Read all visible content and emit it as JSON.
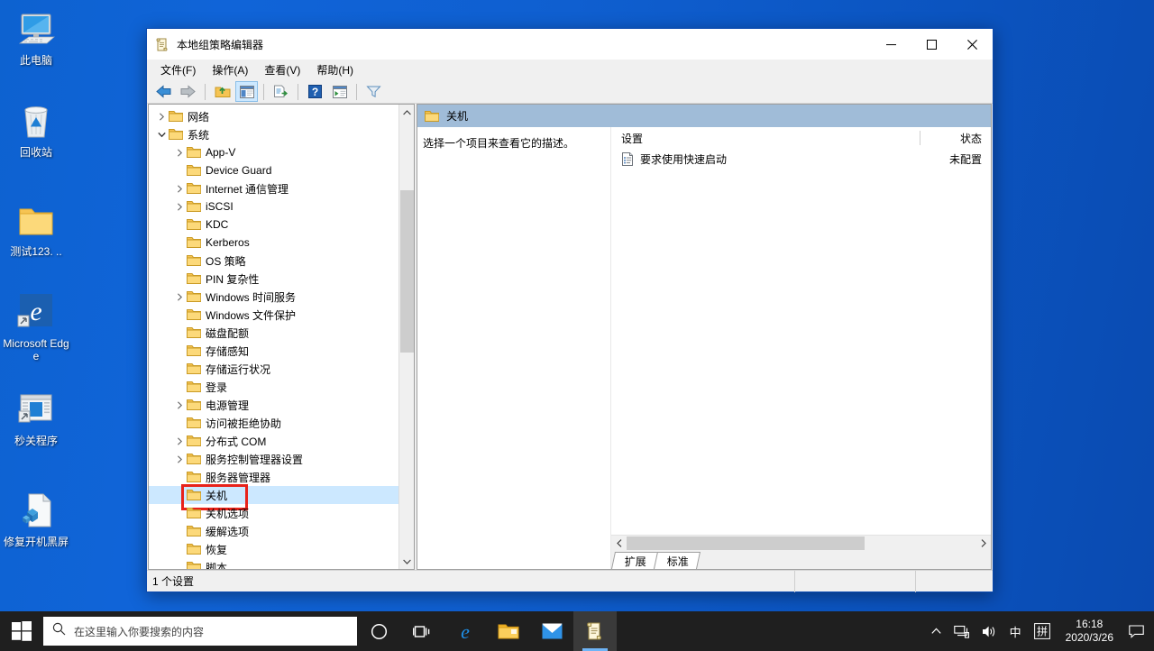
{
  "desktop": {
    "icons": [
      {
        "name": "this-pc",
        "label": "此电脑"
      },
      {
        "name": "recycle-bin",
        "label": "回收站"
      },
      {
        "name": "folder-test123",
        "label": "测试123. .."
      },
      {
        "name": "microsoft-edge",
        "label": "Microsoft Edge"
      },
      {
        "name": "quick-shutdown-program",
        "label": "秒关程序"
      },
      {
        "name": "fix-black-screen",
        "label": "修复开机黑屏"
      }
    ]
  },
  "window": {
    "title": "本地组策略编辑器",
    "icon": "policy-scroll-icon",
    "controls": {
      "minimize": "—",
      "maximize": "☐",
      "close": "✕"
    },
    "menu": [
      "文件(F)",
      "操作(A)",
      "查看(V)",
      "帮助(H)"
    ],
    "toolbar_icons": [
      "back-arrow-icon",
      "forward-arrow-icon",
      "up-folder-icon",
      "show-hide-tree-icon",
      "export-list-icon",
      "help-icon",
      "properties-icon",
      "filter-icon"
    ]
  },
  "tree": {
    "items": [
      {
        "label": "网络",
        "indent": 1,
        "chevron": "collapsed",
        "selected": false
      },
      {
        "label": "系统",
        "indent": 1,
        "chevron": "expanded",
        "selected": false
      },
      {
        "label": "App-V",
        "indent": 2,
        "chevron": "collapsed",
        "selected": false
      },
      {
        "label": "Device Guard",
        "indent": 2,
        "chevron": "none",
        "selected": false
      },
      {
        "label": "Internet 通信管理",
        "indent": 2,
        "chevron": "collapsed",
        "selected": false
      },
      {
        "label": "iSCSI",
        "indent": 2,
        "chevron": "collapsed",
        "selected": false
      },
      {
        "label": "KDC",
        "indent": 2,
        "chevron": "none",
        "selected": false
      },
      {
        "label": "Kerberos",
        "indent": 2,
        "chevron": "none",
        "selected": false
      },
      {
        "label": "OS 策略",
        "indent": 2,
        "chevron": "none",
        "selected": false
      },
      {
        "label": "PIN 复杂性",
        "indent": 2,
        "chevron": "none",
        "selected": false
      },
      {
        "label": "Windows 时间服务",
        "indent": 2,
        "chevron": "collapsed",
        "selected": false
      },
      {
        "label": "Windows 文件保护",
        "indent": 2,
        "chevron": "none",
        "selected": false
      },
      {
        "label": "磁盘配额",
        "indent": 2,
        "chevron": "none",
        "selected": false
      },
      {
        "label": "存储感知",
        "indent": 2,
        "chevron": "none",
        "selected": false
      },
      {
        "label": "存储运行状况",
        "indent": 2,
        "chevron": "none",
        "selected": false
      },
      {
        "label": "登录",
        "indent": 2,
        "chevron": "none",
        "selected": false
      },
      {
        "label": "电源管理",
        "indent": 2,
        "chevron": "collapsed",
        "selected": false
      },
      {
        "label": "访问被拒绝协助",
        "indent": 2,
        "chevron": "none",
        "selected": false
      },
      {
        "label": "分布式 COM",
        "indent": 2,
        "chevron": "collapsed",
        "selected": false
      },
      {
        "label": "服务控制管理器设置",
        "indent": 2,
        "chevron": "collapsed",
        "selected": false
      },
      {
        "label": "服务器管理器",
        "indent": 2,
        "chevron": "none",
        "selected": false
      },
      {
        "label": "关机",
        "indent": 2,
        "chevron": "none",
        "selected": true
      },
      {
        "label": "关机选项",
        "indent": 2,
        "chevron": "none",
        "selected": false
      },
      {
        "label": "缓解选项",
        "indent": 2,
        "chevron": "none",
        "selected": false
      },
      {
        "label": "恢复",
        "indent": 2,
        "chevron": "none",
        "selected": false
      },
      {
        "label": "脚本",
        "indent": 2,
        "chevron": "none",
        "selected": false
      }
    ],
    "scroll_up": "▲",
    "scroll_down": "▼"
  },
  "right_pane": {
    "header_title": "关机",
    "description": "选择一个项目来查看它的描述。",
    "columns": [
      "设置",
      "状态"
    ],
    "rows": [
      {
        "setting": "要求使用快速启动",
        "state": "未配置",
        "icon": "policy-setting-icon"
      }
    ],
    "hscroll": {
      "left": "‹",
      "right": "›"
    },
    "tabs": [
      {
        "label": "扩展",
        "active": false
      },
      {
        "label": "标准",
        "active": true
      }
    ]
  },
  "status_bar": {
    "text": "1 个设置"
  },
  "taskbar": {
    "start_icon": "windows-start-icon",
    "search_placeholder": "在这里输入你要搜索的内容",
    "search_icon": "search-icon",
    "apps": [
      {
        "name": "cortana-icon",
        "running": false
      },
      {
        "name": "task-view-icon",
        "running": false
      },
      {
        "name": "edge-icon",
        "running": false
      },
      {
        "name": "file-explorer-icon",
        "running": false
      },
      {
        "name": "mail-icon",
        "running": false
      },
      {
        "name": "gpedit-icon",
        "running": true
      }
    ],
    "tray": [
      {
        "name": "show-hidden-icons",
        "glyph": "⌃"
      },
      {
        "name": "network-icon",
        "glyph": "🖳"
      },
      {
        "name": "volume-icon",
        "glyph": "🔊"
      },
      {
        "name": "ime-mode",
        "glyph": "中"
      },
      {
        "name": "ime-pinyin",
        "glyph": "拼"
      }
    ],
    "clock": {
      "time": "16:18",
      "date": "2020/3/26"
    },
    "action_center_icon": "notification-icon"
  },
  "colors": {
    "desktop": "#0d62d0",
    "selection": "#cce8ff",
    "highlight_box": "#e8221a",
    "pane_header": "#a0bcd8",
    "taskbar": "#1f1f1f"
  }
}
